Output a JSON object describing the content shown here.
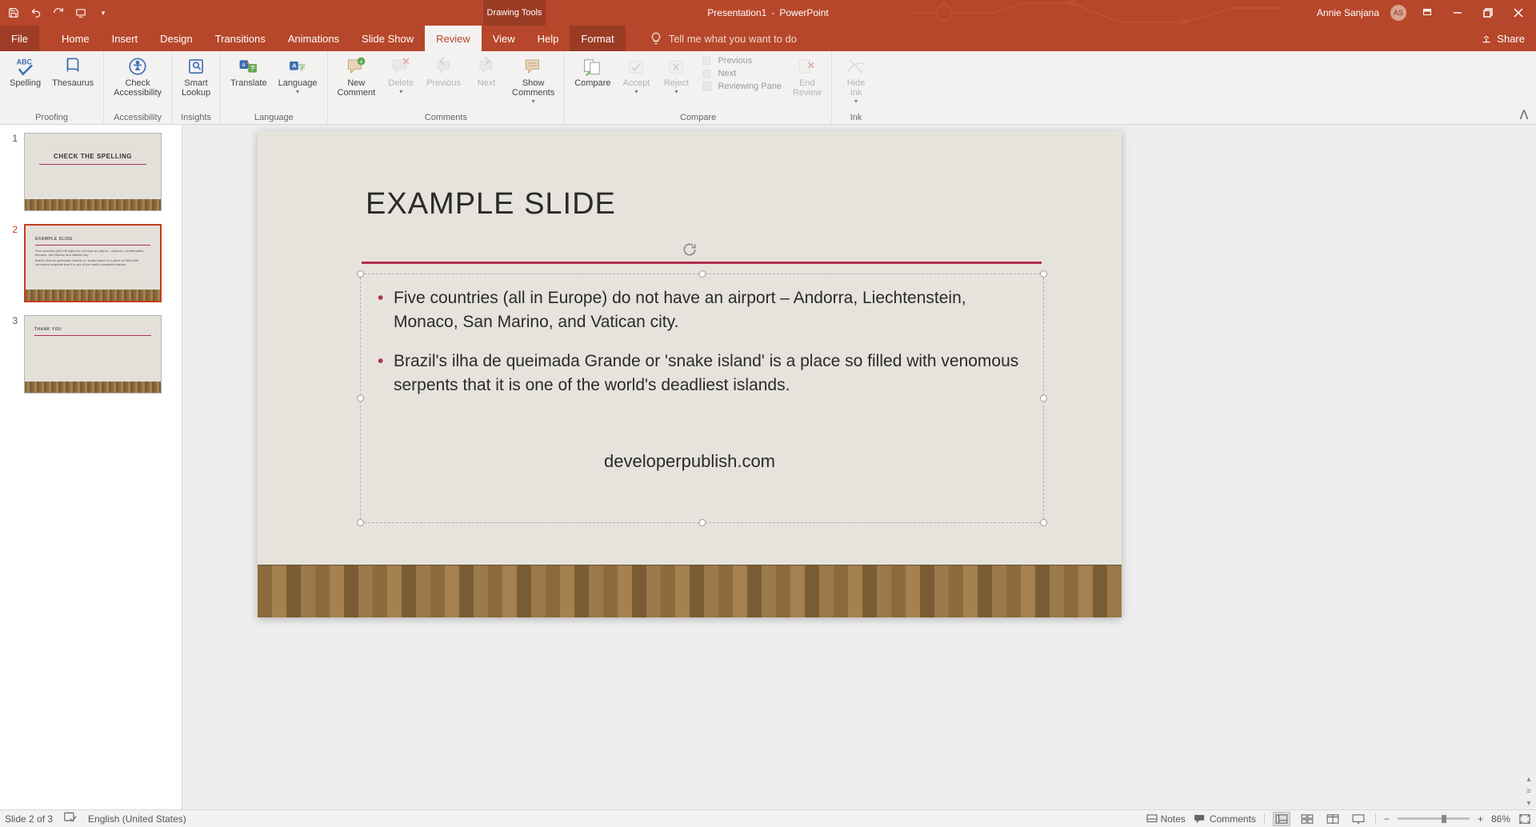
{
  "titlebar": {
    "doc_name": "Presentation1",
    "app_name": "PowerPoint",
    "context_tab": "Drawing Tools",
    "user_name": "Annie Sanjana",
    "user_initials": "AS"
  },
  "tabs": {
    "file": "File",
    "home": "Home",
    "insert": "Insert",
    "design": "Design",
    "transitions": "Transitions",
    "animations": "Animations",
    "slideshow": "Slide Show",
    "review": "Review",
    "view": "View",
    "help": "Help",
    "format": "Format",
    "tell_me": "Tell me what you want to do",
    "share": "Share"
  },
  "ribbon": {
    "groups": {
      "proofing": "Proofing",
      "accessibility": "Accessibility",
      "insights": "Insights",
      "language": "Language",
      "comments": "Comments",
      "compare": "Compare",
      "ink": "Ink"
    },
    "buttons": {
      "spelling": "Spelling",
      "thesaurus": "Thesaurus",
      "check_accessibility": "Check\nAccessibility",
      "smart_lookup": "Smart\nLookup",
      "translate": "Translate",
      "language": "Language",
      "new_comment": "New\nComment",
      "delete": "Delete",
      "previous": "Previous",
      "next": "Next",
      "show_comments": "Show\nComments",
      "compare": "Compare",
      "accept": "Accept",
      "reject": "Reject",
      "prev_change": "Previous",
      "next_change": "Next",
      "reviewing_pane": "Reviewing Pane",
      "end_review": "End\nReview",
      "hide_ink": "Hide\nInk"
    }
  },
  "thumbnails": [
    {
      "num": "1",
      "title": "CHECK THE SPELLING"
    },
    {
      "num": "2",
      "title": "EXAMPLE SLIDE"
    },
    {
      "num": "3",
      "title": "THANK YOU"
    }
  ],
  "slide": {
    "title": "EXAMPLE SLIDE",
    "bullets": [
      "Five countries (all in Europe) do not have an airport – Andorra, Liechtenstein, Monaco, San Marino, and Vatican city.",
      "Brazil's ilha de queimada Grande or 'snake island' is a place so filled with venomous serpents that it is one of the world's deadliest islands."
    ],
    "footer": "developerpublish.com"
  },
  "statusbar": {
    "slide_indicator": "Slide 2 of 3",
    "language": "English (United States)",
    "notes": "Notes",
    "comments": "Comments",
    "zoom_pct": "86%"
  }
}
